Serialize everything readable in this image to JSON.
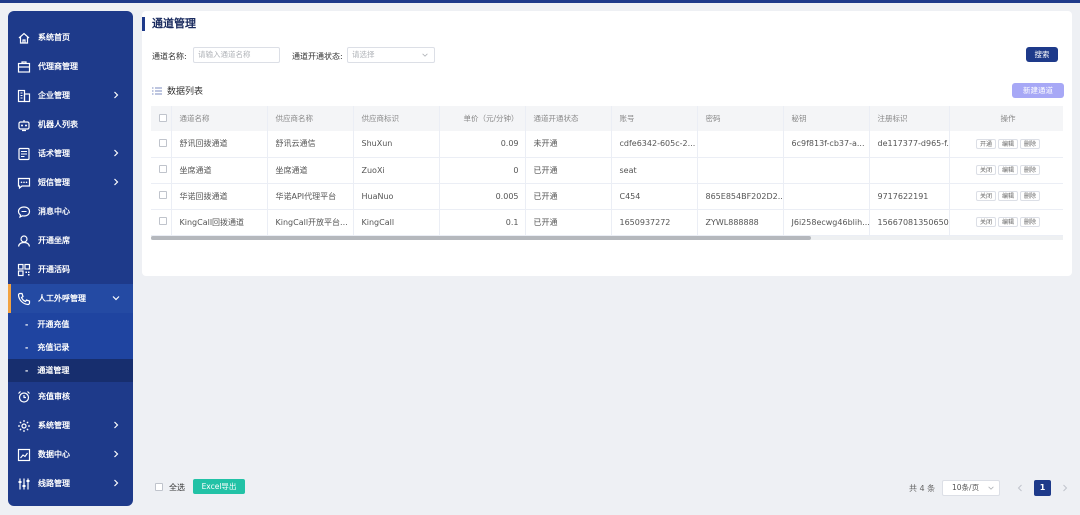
{
  "sidebar": {
    "items": [
      {
        "label": "系统首页",
        "icon": "home-icon",
        "has_arrow": false
      },
      {
        "label": "代理商管理",
        "icon": "briefcase-icon",
        "has_arrow": false
      },
      {
        "label": "企业管理",
        "icon": "building-icon",
        "has_arrow": true
      },
      {
        "label": "机器人列表",
        "icon": "robot-icon",
        "has_arrow": false
      },
      {
        "label": "话术管理",
        "icon": "script-icon",
        "has_arrow": true
      },
      {
        "label": "短信管理",
        "icon": "message-icon",
        "has_arrow": true
      },
      {
        "label": "消息中心",
        "icon": "chat-icon",
        "has_arrow": false
      },
      {
        "label": "开通坐席",
        "icon": "user-icon",
        "has_arrow": false
      },
      {
        "label": "开通活码",
        "icon": "qrcode-icon",
        "has_arrow": false
      },
      {
        "label": "人工外呼管理",
        "icon": "phone-icon",
        "has_arrow": true,
        "active": true
      }
    ],
    "sub_items": [
      "开通充值",
      "充值记录",
      "通道管理"
    ],
    "items_after": [
      {
        "label": "充值审核",
        "icon": "alarm-icon",
        "has_arrow": false
      },
      {
        "label": "系统管理",
        "icon": "gear-icon",
        "has_arrow": true
      },
      {
        "label": "数据中心",
        "icon": "chart-icon",
        "has_arrow": true
      },
      {
        "label": "线路管理",
        "icon": "sliders-icon",
        "has_arrow": true
      }
    ],
    "sub_dash": "-"
  },
  "page": {
    "title": "通道管理",
    "filter_name_label": "通道名称:",
    "filter_name_placeholder": "请输入通道名称",
    "filter_status_label": "通道开通状态:",
    "filter_status_placeholder": "请选择",
    "search_label": "搜索",
    "list_title": "数据列表",
    "new_label": "新建通道"
  },
  "table": {
    "headers": [
      "通道名称",
      "供应商名称",
      "供应商标识",
      "单价（元/分钟）",
      "通道开通状态",
      "账号",
      "密码",
      "秘钥",
      "注册标识",
      "操作"
    ],
    "rows": [
      {
        "name": "舒讯回拨通道",
        "supplier": "舒讯云通信",
        "supplier_id": "ShuXun",
        "price": "0.09",
        "status": "未开通",
        "account": "cdfe6342-605c-2...",
        "password": "",
        "secret": "6c9f813f-cb37-a...",
        "reg": "de117377-d965-f...",
        "toggle": "开通",
        "edit": "编辑",
        "del": "删除"
      },
      {
        "name": "坐席通道",
        "supplier": "坐席通道",
        "supplier_id": "ZuoXi",
        "price": "0",
        "status": "已开通",
        "account": "seat",
        "password": "",
        "secret": "",
        "reg": "",
        "toggle": "关闭",
        "edit": "编辑",
        "del": "删除"
      },
      {
        "name": "华诺回拨通道",
        "supplier": "华诺API代理平台",
        "supplier_id": "HuaNuo",
        "price": "0.005",
        "status": "已开通",
        "account": "C454",
        "password": "865E854BF202D2...",
        "secret": "",
        "reg": "9717622191",
        "toggle": "关闭",
        "edit": "编辑",
        "del": "删除"
      },
      {
        "name": "KingCall回拨通道",
        "supplier": "KingCall开放平台...",
        "supplier_id": "KingCall",
        "price": "0.1",
        "status": "已开通",
        "account": "1650937272",
        "password": "ZYWL888888",
        "secret": "J6i258ecwg46blih...",
        "reg": "15667081350650...",
        "toggle": "关闭",
        "edit": "编辑",
        "del": "删除"
      }
    ]
  },
  "footer": {
    "select_all": "全选",
    "excel_label": "Excel导出",
    "total": "共 4 条",
    "page_size": "10条/页",
    "current_page": "1"
  }
}
